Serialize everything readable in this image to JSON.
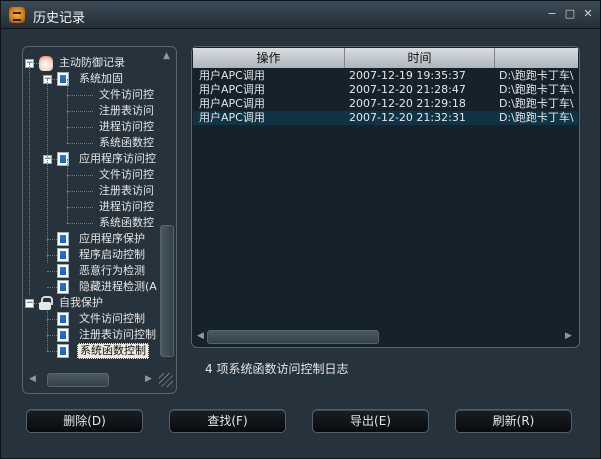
{
  "window": {
    "title": "历史记录"
  },
  "tree": {
    "nodes": [
      {
        "label": "主动防御记录",
        "level": 0,
        "icon": "shield-hand-icon"
      },
      {
        "label": "系统加固",
        "level": 1,
        "icon": "document-icon"
      },
      {
        "label": "文件访问控",
        "level": 2,
        "icon": ""
      },
      {
        "label": "注册表访问",
        "level": 2,
        "icon": ""
      },
      {
        "label": "进程访问控",
        "level": 2,
        "icon": ""
      },
      {
        "label": "系统函数控",
        "level": 2,
        "icon": ""
      },
      {
        "label": "应用程序访问控",
        "level": 1,
        "icon": "document-icon"
      },
      {
        "label": "文件访问控",
        "level": 2,
        "icon": ""
      },
      {
        "label": "注册表访问",
        "level": 2,
        "icon": ""
      },
      {
        "label": "进程访问控",
        "level": 2,
        "icon": ""
      },
      {
        "label": "系统函数控",
        "level": 2,
        "icon": ""
      },
      {
        "label": "应用程序保护",
        "level": 1,
        "icon": "document-icon"
      },
      {
        "label": "程序启动控制",
        "level": 1,
        "icon": "document-icon"
      },
      {
        "label": "恶意行为检测",
        "level": 1,
        "icon": "document-icon"
      },
      {
        "label": "隐藏进程检测(A",
        "level": 1,
        "icon": "document-icon"
      },
      {
        "label": "自我保护",
        "level": 0,
        "icon": "lock-icon"
      },
      {
        "label": "文件访问控制",
        "level": 1,
        "icon": "document-icon"
      },
      {
        "label": "注册表访问控制",
        "level": 1,
        "icon": "document-icon"
      },
      {
        "label": "系统函数控制",
        "level": 1,
        "icon": "document-icon",
        "selected": true
      }
    ]
  },
  "list": {
    "columns": [
      "操作",
      "时间",
      ""
    ],
    "rows": [
      {
        "op": "用户APC调用",
        "time": "2007-12-19 19:35:37",
        "path": "D:\\跑跑卡丁车\\"
      },
      {
        "op": "用户APC调用",
        "time": "2007-12-20 21:28:47",
        "path": "D:\\跑跑卡丁车\\"
      },
      {
        "op": "用户APC调用",
        "time": "2007-12-20 21:29:18",
        "path": "D:\\跑跑卡丁车\\"
      },
      {
        "op": "用户APC调用",
        "time": "2007-12-20 21:32:31",
        "path": "D:\\跑跑卡丁车\\",
        "selected": true
      }
    ]
  },
  "status": {
    "text": "4 项系统函数访问控制日志"
  },
  "buttons": {
    "delete": "删除(D)",
    "find": "查找(F)",
    "export": "导出(E)",
    "refresh": "刷新(R)"
  },
  "colors": {
    "window_bg": "#26333d",
    "list_bg": "#15212b",
    "selected_row": "#0f3446"
  }
}
